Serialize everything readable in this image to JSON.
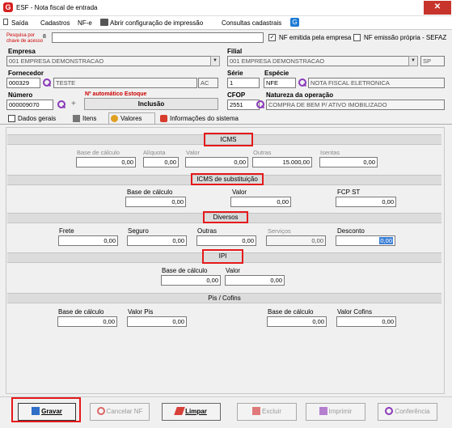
{
  "window": {
    "title": "ESF - Nota fiscal de entrada",
    "close_label": "✕"
  },
  "menu": {
    "items": [
      "Saída",
      "Cadastros",
      "NF-e",
      "Abrir configuração de impressão",
      "Consultas cadastrais"
    ]
  },
  "search": {
    "label_line1": "Pesquisa por",
    "label_line2": "chave de acesso",
    "badge": "8",
    "value": "",
    "nf_emitida_label": "NF emitida pela empresa",
    "nf_emitida_checked": true,
    "nf_propria_label": "NF emissão própria - SEFAZ",
    "nf_propria_checked": false
  },
  "form": {
    "empresa_label": "Empresa",
    "empresa_value": "001 EMPRESA DEMONSTRACAO",
    "filial_label": "Filial",
    "filial_value": "001 EMPRESA DEMONSTRACAO",
    "filial_uf": "SP",
    "fornecedor_label": "Fornecedor",
    "fornecedor_code": "000329",
    "fornecedor_name": "TESTE",
    "fornecedor_uf": "AC",
    "serie_label": "Série",
    "serie_value": "1",
    "especie_label": "Espécie",
    "especie_code": "NFE",
    "especie_desc": "NOTA FISCAL ELETRONICA",
    "numero_label": "Número",
    "numero_value": "000009070",
    "auto_estoque_label": "Nº automático Estoque",
    "inclusao_value": "Inclusão",
    "cfop_label": "CFOP",
    "cfop_value": "2551",
    "natureza_label": "Natureza da operação",
    "natureza_value": "COMPRA DE BEM P/ ATIVO IMOBILIZADO"
  },
  "tabs": [
    "Dados gerais",
    "Itens",
    "Valores",
    "Informações do sistema"
  ],
  "icms": {
    "title": "ICMS",
    "labels": [
      "Base de cálculo",
      "Alíquota",
      "Valor",
      "Outras",
      "Isentas"
    ],
    "values": [
      "0,00",
      "0,00",
      "0,00",
      "15.000,00",
      "0,00"
    ]
  },
  "icms_st": {
    "title": "ICMS de substituição",
    "labels": [
      "Base de cálculo",
      "Valor",
      "FCP ST"
    ],
    "values": [
      "0,00",
      "0,00",
      "0,00"
    ]
  },
  "diversos": {
    "title": "Diversos",
    "labels": [
      "Frete",
      "Seguro",
      "Outras",
      "Serviços",
      "Desconto"
    ],
    "values": [
      "0,00",
      "0,00",
      "0,00",
      "0,00",
      "0,00"
    ]
  },
  "ipi": {
    "title": "IPI",
    "labels": [
      "Base de cálculo",
      "Valor"
    ],
    "values": [
      "0,00",
      "0,00"
    ]
  },
  "pis_cofins": {
    "title": "Pis / Cofins",
    "labels": [
      "Base de cálculo",
      "Valor Pis",
      "Base de cálculo",
      "Valor Cofins"
    ],
    "values": [
      "0,00",
      "0,00",
      "0,00",
      "0,00"
    ]
  },
  "buttons": {
    "gravar": "Gravar",
    "cancelar": "Cancelar NF",
    "limpar": "Limpar",
    "excluir": "Excluir",
    "imprimir": "Imprimir",
    "conferencia": "Conferência"
  },
  "colors": {
    "highlight_red": "#e5191b",
    "close_red": "#c7342c",
    "search_icon": "#8a3ab9"
  }
}
